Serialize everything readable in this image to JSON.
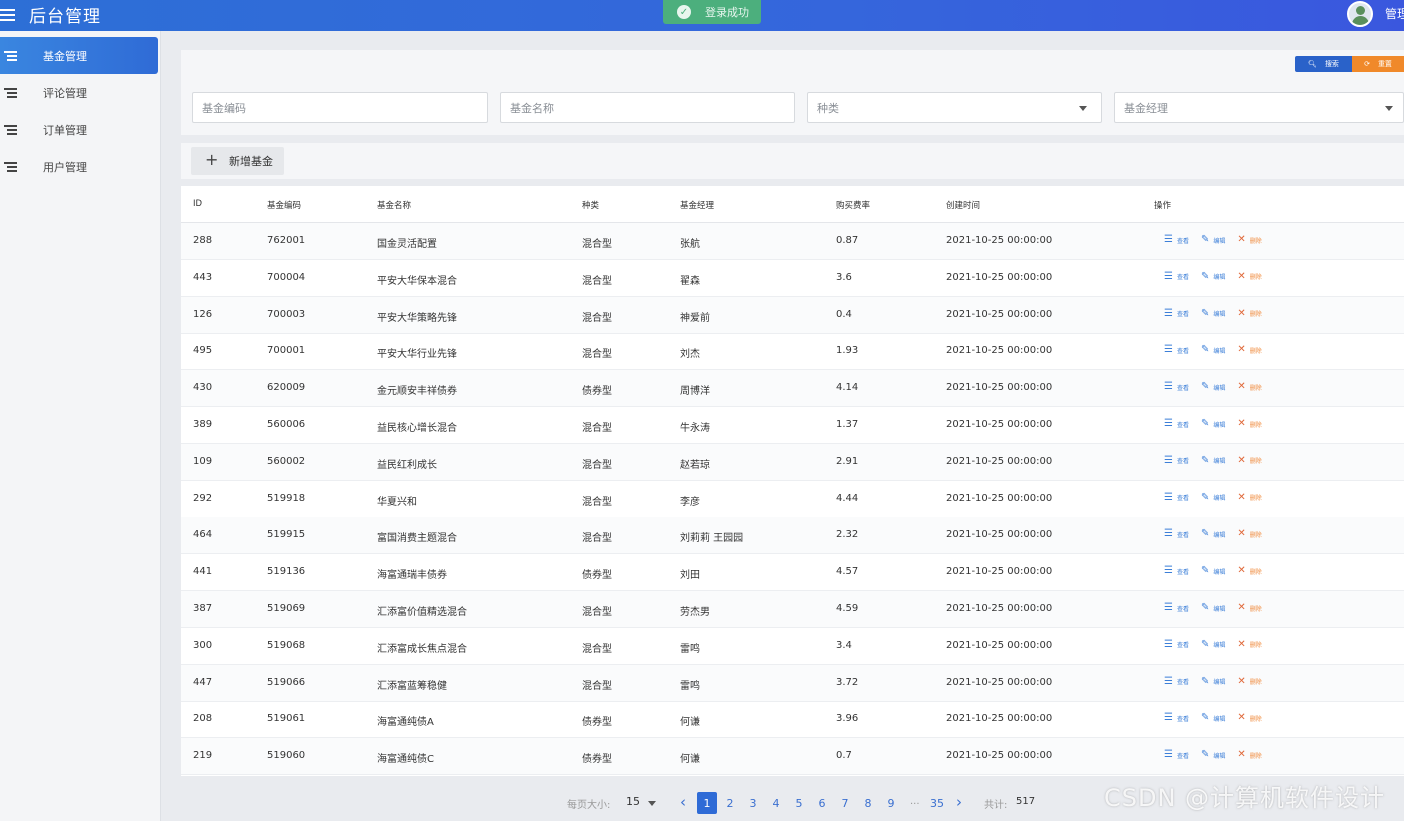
{
  "header": {
    "title": "后台管理",
    "toast": "登录成功",
    "user": "管理"
  },
  "sidebar": {
    "items": [
      {
        "label": "基金管理",
        "active": true
      },
      {
        "label": "评论管理",
        "active": false
      },
      {
        "label": "订单管理",
        "active": false
      },
      {
        "label": "用户管理",
        "active": false
      }
    ]
  },
  "toolbar": {
    "search_label": "搜索",
    "reset_label": "重置",
    "add_label": "新增基金"
  },
  "filters": {
    "code_placeholder": "基金编码",
    "name_placeholder": "基金名称",
    "type_placeholder": "种类",
    "manager_placeholder": "基金经理"
  },
  "table": {
    "columns": [
      "ID",
      "基金编码",
      "基金名称",
      "种类",
      "基金经理",
      "购买费率",
      "创建时间",
      "操作"
    ],
    "op_labels": {
      "view": "查看",
      "edit": "编辑",
      "delete": "删除"
    },
    "rows": [
      [
        "288",
        "762001",
        "国金灵活配置",
        "混合型",
        "张航",
        "0.87",
        "2021-10-25 00:00:00"
      ],
      [
        "443",
        "700004",
        "平安大华保本混合",
        "混合型",
        "翟森",
        "3.6",
        "2021-10-25 00:00:00"
      ],
      [
        "126",
        "700003",
        "平安大华策略先锋",
        "混合型",
        "神爱前",
        "0.4",
        "2021-10-25 00:00:00"
      ],
      [
        "495",
        "700001",
        "平安大华行业先锋",
        "混合型",
        "刘杰",
        "1.93",
        "2021-10-25 00:00:00"
      ],
      [
        "430",
        "620009",
        "金元顺安丰祥债券",
        "债券型",
        "周博洋",
        "4.14",
        "2021-10-25 00:00:00"
      ],
      [
        "389",
        "560006",
        "益民核心增长混合",
        "混合型",
        "牛永涛",
        "1.37",
        "2021-10-25 00:00:00"
      ],
      [
        "109",
        "560002",
        "益民红利成长",
        "混合型",
        "赵若琼",
        "2.91",
        "2021-10-25 00:00:00"
      ],
      [
        "292",
        "519918",
        "华夏兴和",
        "混合型",
        "李彦",
        "4.44",
        "2021-10-25 00:00:00"
      ],
      [
        "464",
        "519915",
        "富国消费主题混合",
        "混合型",
        "刘莉莉 王园园",
        "2.32",
        "2021-10-25 00:00:00"
      ],
      [
        "441",
        "519136",
        "海富通瑞丰债券",
        "债券型",
        "刘田",
        "4.57",
        "2021-10-25 00:00:00"
      ],
      [
        "387",
        "519069",
        "汇添富价值精选混合",
        "混合型",
        "劳杰男",
        "4.59",
        "2021-10-25 00:00:00"
      ],
      [
        "300",
        "519068",
        "汇添富成长焦点混合",
        "混合型",
        "雷鸣",
        "3.4",
        "2021-10-25 00:00:00"
      ],
      [
        "447",
        "519066",
        "汇添富蓝筹稳健",
        "混合型",
        "雷鸣",
        "3.72",
        "2021-10-25 00:00:00"
      ],
      [
        "208",
        "519061",
        "海富通纯债A",
        "债券型",
        "何谦",
        "3.96",
        "2021-10-25 00:00:00"
      ],
      [
        "219",
        "519060",
        "海富通纯债C",
        "债券型",
        "何谦",
        "0.7",
        "2021-10-25 00:00:00"
      ]
    ]
  },
  "pagination": {
    "page_size_label": "每页大小:",
    "page_size": "15",
    "pages": [
      "1",
      "2",
      "3",
      "4",
      "5",
      "6",
      "7",
      "8",
      "9"
    ],
    "current": "1",
    "ellipsis": "...",
    "last": "35",
    "total_label": "共计:",
    "total": "517"
  },
  "watermark": "CSDN @计算机软件设计",
  "colors": {
    "primary": "#2f6bd6",
    "warning": "#f0892a",
    "success": "#4caf7d"
  }
}
